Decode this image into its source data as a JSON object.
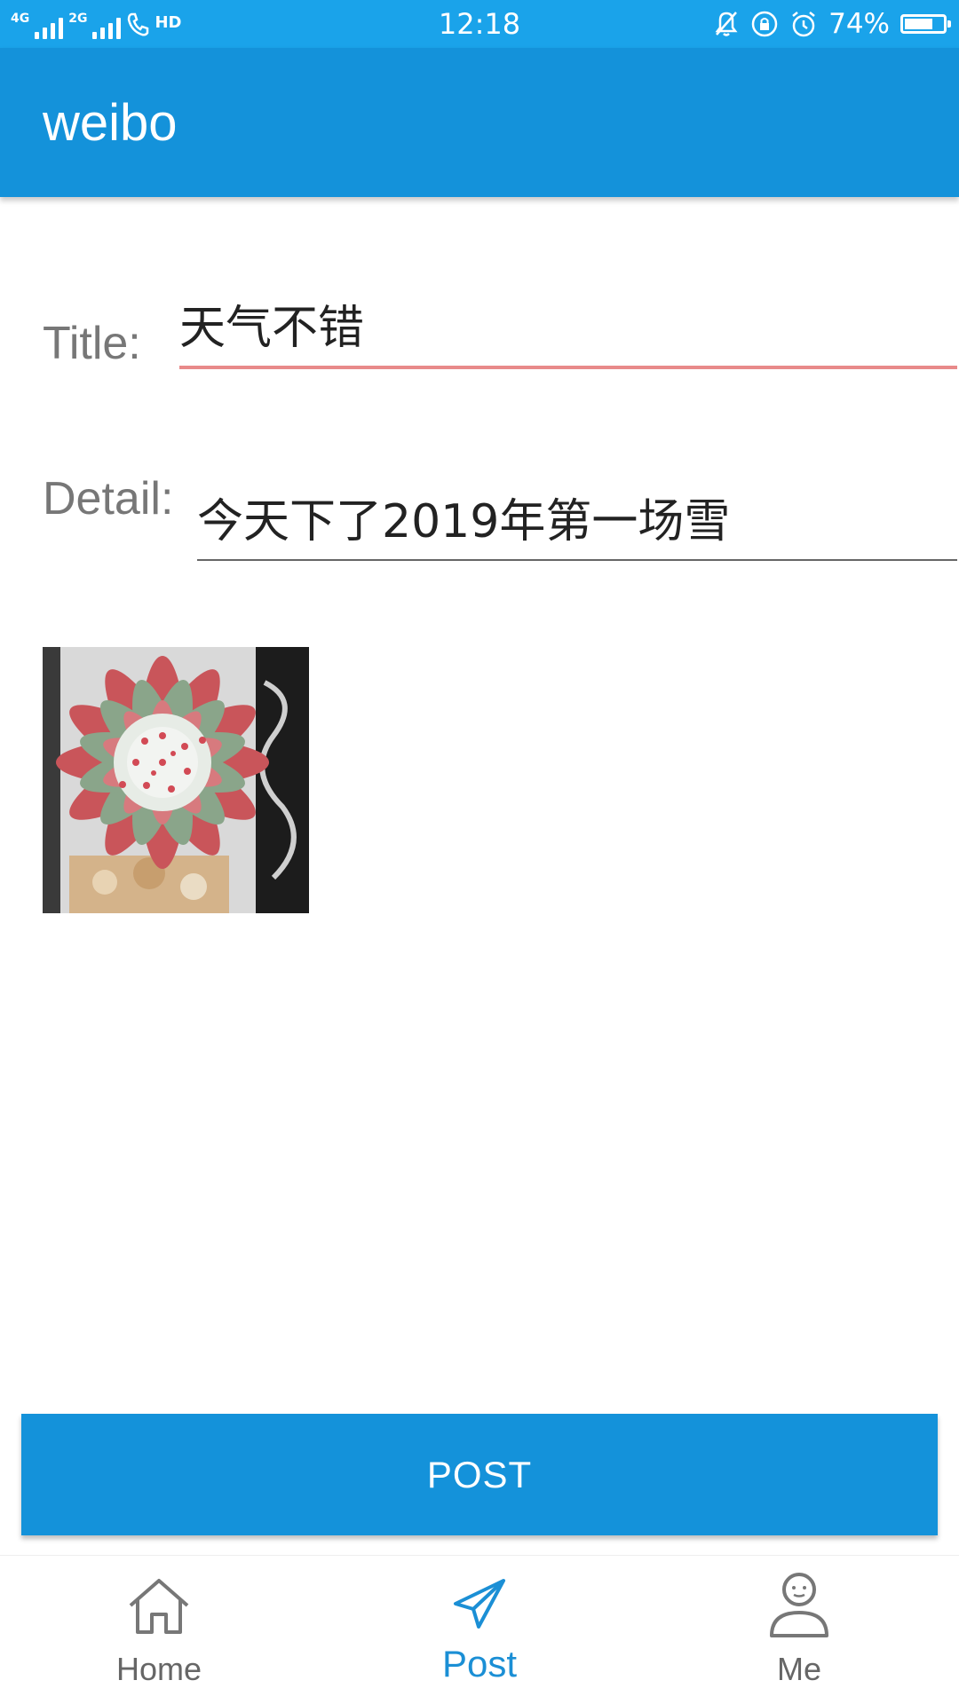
{
  "status_bar": {
    "network_1": "4G",
    "network_2": "2G",
    "hd": "HD",
    "time": "12:18",
    "battery_percent": "74%",
    "battery_level": 0.74,
    "icons": [
      "mute-icon",
      "rotation-lock-icon",
      "alarm-icon",
      "battery-icon"
    ]
  },
  "app_bar": {
    "title": "weibo",
    "color": "#1492da"
  },
  "form": {
    "title_label": "Title:",
    "title_value": "天气不错",
    "detail_label": "Detail:",
    "detail_value": "今天下了2019年第一场雪",
    "focused_underline_color": "#e88a8a"
  },
  "photo": {
    "subject": "succulent-photo"
  },
  "post_button": {
    "label": "POST"
  },
  "bottom_nav": {
    "items": [
      {
        "label": "Home",
        "icon": "home-icon",
        "active": false
      },
      {
        "label": "Post",
        "icon": "paper-plane-icon",
        "active": true
      },
      {
        "label": "Me",
        "icon": "person-icon",
        "active": false
      }
    ],
    "active_color": "#1b8fd5"
  }
}
